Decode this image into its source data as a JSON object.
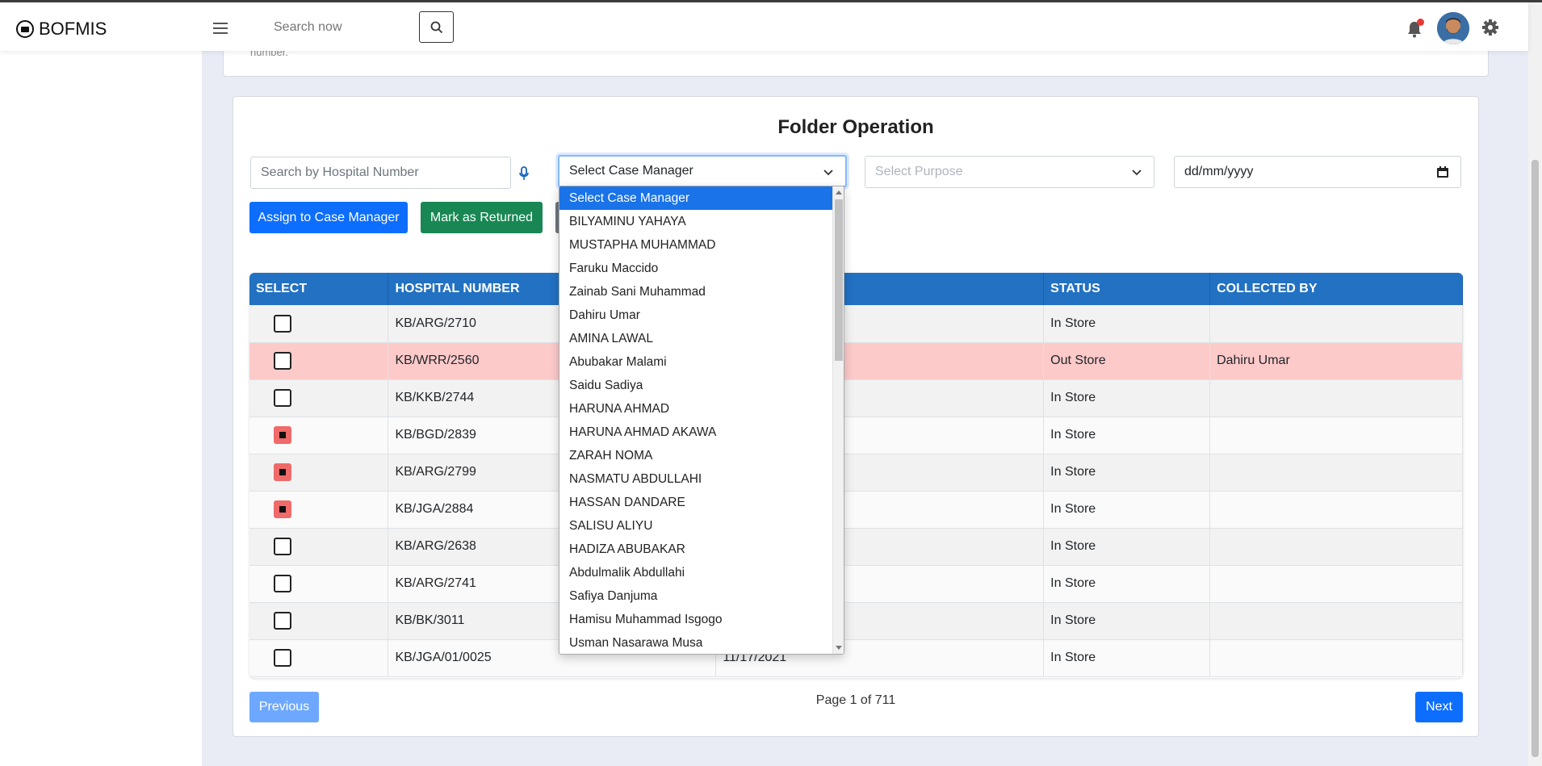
{
  "app": {
    "brand": "BOFMIS"
  },
  "navbar": {
    "search_placeholder": "Search now"
  },
  "top_card": {
    "text": "number."
  },
  "main": {
    "title": "Folder Operation",
    "hospital_search_placeholder": "Search by Hospital Number",
    "case_manager_select": "Select Case Manager",
    "purpose_select": "Select Purpose",
    "date_placeholder": "dd/mm/yyyy",
    "assign_button": "Assign to Case Manager",
    "return_button": "Mark as Returned"
  },
  "table": {
    "headers": [
      "SELECT",
      "HOSPITAL NUMBER",
      "",
      "STATUS",
      "COLLECTED BY"
    ],
    "rows": [
      {
        "checked": false,
        "hospital_number": "KB/ARG/2710",
        "date": "",
        "status": "In Store",
        "collected_by": ""
      },
      {
        "checked": false,
        "hospital_number": "KB/WRR/2560",
        "date": "",
        "status": "Out Store",
        "collected_by": "Dahiru Umar"
      },
      {
        "checked": false,
        "hospital_number": "KB/KKB/2744",
        "date": "",
        "status": "In Store",
        "collected_by": ""
      },
      {
        "checked": true,
        "hospital_number": "KB/BGD/2839",
        "date": "",
        "status": "In Store",
        "collected_by": ""
      },
      {
        "checked": true,
        "hospital_number": "KB/ARG/2799",
        "date": "",
        "status": "In Store",
        "collected_by": ""
      },
      {
        "checked": true,
        "hospital_number": "KB/JGA/2884",
        "date": "",
        "status": "In Store",
        "collected_by": ""
      },
      {
        "checked": false,
        "hospital_number": "KB/ARG/2638",
        "date": "",
        "status": "In Store",
        "collected_by": ""
      },
      {
        "checked": false,
        "hospital_number": "KB/ARG/2741",
        "date": "",
        "status": "In Store",
        "collected_by": ""
      },
      {
        "checked": false,
        "hospital_number": "KB/BK/3011",
        "date": "",
        "status": "In Store",
        "collected_by": ""
      },
      {
        "checked": false,
        "hospital_number": "KB/JGA/01/0025",
        "date": "11/17/2021",
        "status": "In Store",
        "collected_by": ""
      }
    ]
  },
  "pagination": {
    "previous": "Previous",
    "next": "Next",
    "info": "Page 1 of 711"
  },
  "dropdown": {
    "options": [
      "Select Case Manager",
      "BILYAMINU YAHAYA",
      "MUSTAPHA MUHAMMAD",
      "Faruku Maccido",
      "Zainab Sani Muhammad",
      "Dahiru Umar",
      "AMINA LAWAL",
      "Abubakar Malami",
      "Saidu Sadiya",
      "HARUNA AHMAD",
      "HARUNA AHMAD AKAWA",
      "ZARAH NOMA",
      "NASMATU ABDULLAHI",
      "HASSAN DANDARE",
      "SALISU ALIYU",
      "HADIZA ABUBAKAR",
      "Abdulmalik Abdullahi",
      "Safiya Danjuma",
      "Hamisu Muhammad Isgogo",
      "Usman Nasarawa Musa"
    ],
    "selected_index": 0
  },
  "colors": {
    "primary": "#0d6efd",
    "success": "#198754",
    "header": "#2271c3",
    "outstore_row": "#fdcaca",
    "checked": "#f06a6a"
  }
}
